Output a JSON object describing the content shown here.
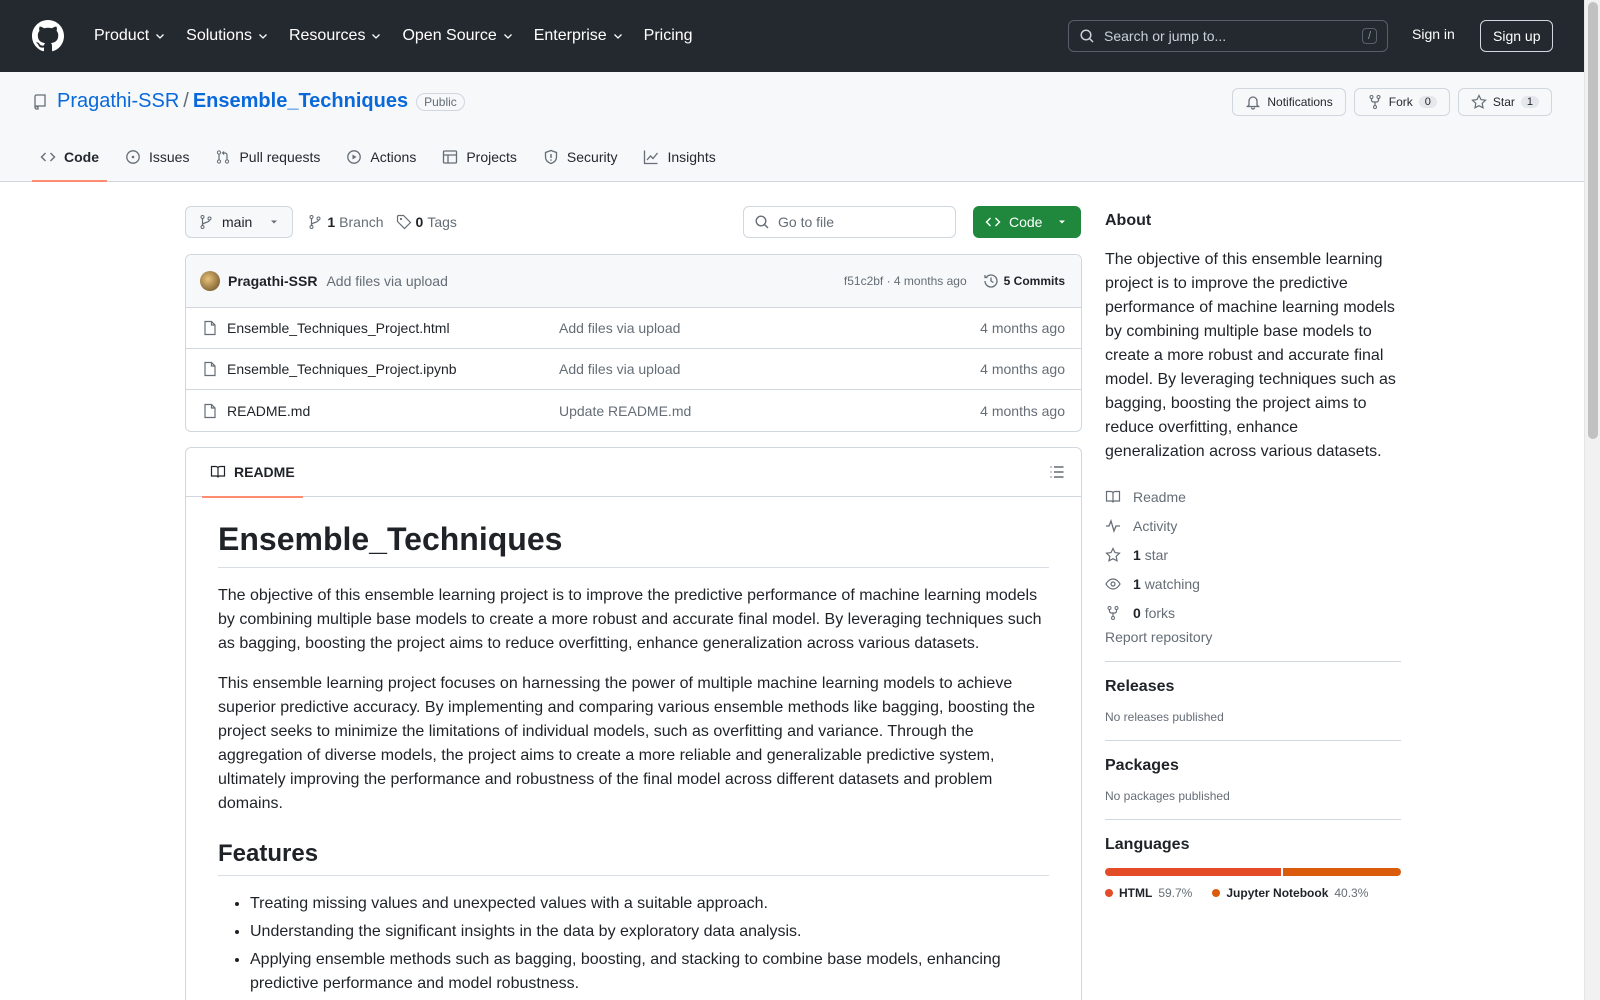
{
  "header": {
    "nav": [
      {
        "label": "Product",
        "has_dropdown": true
      },
      {
        "label": "Solutions",
        "has_dropdown": true
      },
      {
        "label": "Resources",
        "has_dropdown": true
      },
      {
        "label": "Open Source",
        "has_dropdown": true
      },
      {
        "label": "Enterprise",
        "has_dropdown": true
      },
      {
        "label": "Pricing",
        "has_dropdown": false
      }
    ],
    "search_placeholder": "Search or jump to...",
    "search_shortcut": "/",
    "sign_in": "Sign in",
    "sign_up": "Sign up"
  },
  "repo": {
    "owner": "Pragathi-SSR",
    "separator": "/",
    "name": "Ensemble_Techniques",
    "visibility": "Public",
    "actions": {
      "notifications": "Notifications",
      "fork": "Fork",
      "fork_count": "0",
      "star": "Star",
      "star_count": "1"
    },
    "tabs": [
      {
        "label": "Code",
        "icon": "code-icon",
        "active": true
      },
      {
        "label": "Issues",
        "icon": "issue-icon"
      },
      {
        "label": "Pull requests",
        "icon": "pull-request-icon"
      },
      {
        "label": "Actions",
        "icon": "play-icon"
      },
      {
        "label": "Projects",
        "icon": "table-icon"
      },
      {
        "label": "Security",
        "icon": "shield-icon"
      },
      {
        "label": "Insights",
        "icon": "graph-icon"
      }
    ]
  },
  "filebar": {
    "branch": "main",
    "branch_count": "1",
    "branch_label": "Branch",
    "tag_count": "0",
    "tag_label": "Tags",
    "go_to_file": "Go to file",
    "code_button": "Code"
  },
  "commit": {
    "author": "Pragathi-SSR",
    "message": "Add files via upload",
    "hash_time": "f51c2bf · 4 months ago",
    "commits": "5 Commits"
  },
  "files": [
    {
      "name": "Ensemble_Techniques_Project.html",
      "message": "Add files via upload",
      "time": "4 months ago"
    },
    {
      "name": "Ensemble_Techniques_Project.ipynb",
      "message": "Add files via upload",
      "time": "4 months ago"
    },
    {
      "name": "README.md",
      "message": "Update README.md",
      "time": "4 months ago"
    }
  ],
  "readme": {
    "tab_label": "README",
    "title": "Ensemble_Techniques",
    "para1": "The objective of this ensemble learning project is to improve the predictive performance of machine learning models by combining multiple base models to create a more robust and accurate final model. By leveraging techniques such as bagging, boosting the project aims to reduce overfitting, enhance generalization across various datasets.",
    "para2": "This ensemble learning project focuses on harnessing the power of multiple machine learning models to achieve superior predictive accuracy. By implementing and comparing various ensemble methods like bagging, boosting the project seeks to minimize the limitations of individual models, such as overfitting and variance. Through the aggregation of diverse models, the project aims to create a more reliable and generalizable predictive system, ultimately improving the performance and robustness of the final model across different datasets and problem domains.",
    "features_heading": "Features",
    "features": [
      "Treating missing values and unexpected values with a suitable approach.",
      "Understanding the significant insights in the data by exploratory data analysis.",
      "Applying ensemble methods such as bagging, boosting, and stacking to combine base models, enhancing predictive performance and model robustness."
    ]
  },
  "sidebar": {
    "about_heading": "About",
    "about_text": "The objective of this ensemble learning project is to improve the predictive performance of machine learning models by combining multiple base models to create a more robust and accurate final model. By leveraging techniques such as bagging, boosting the project aims to reduce overfitting, enhance generalization across various datasets.",
    "links": {
      "readme": "Readme",
      "activity": "Activity",
      "stars_count": "1",
      "stars_label": "star",
      "watching_count": "1",
      "watching_label": "watching",
      "forks_count": "0",
      "forks_label": "forks"
    },
    "report": "Report repository",
    "releases_heading": "Releases",
    "releases_text": "No releases published",
    "packages_heading": "Packages",
    "packages_text": "No packages published",
    "languages_heading": "Languages",
    "languages": [
      {
        "name": "HTML",
        "percent": "59.7%",
        "fraction": 0.597,
        "color": "#e34c26"
      },
      {
        "name": "Jupyter Notebook",
        "percent": "40.3%",
        "fraction": 0.403,
        "color": "#da5b0b"
      }
    ]
  }
}
